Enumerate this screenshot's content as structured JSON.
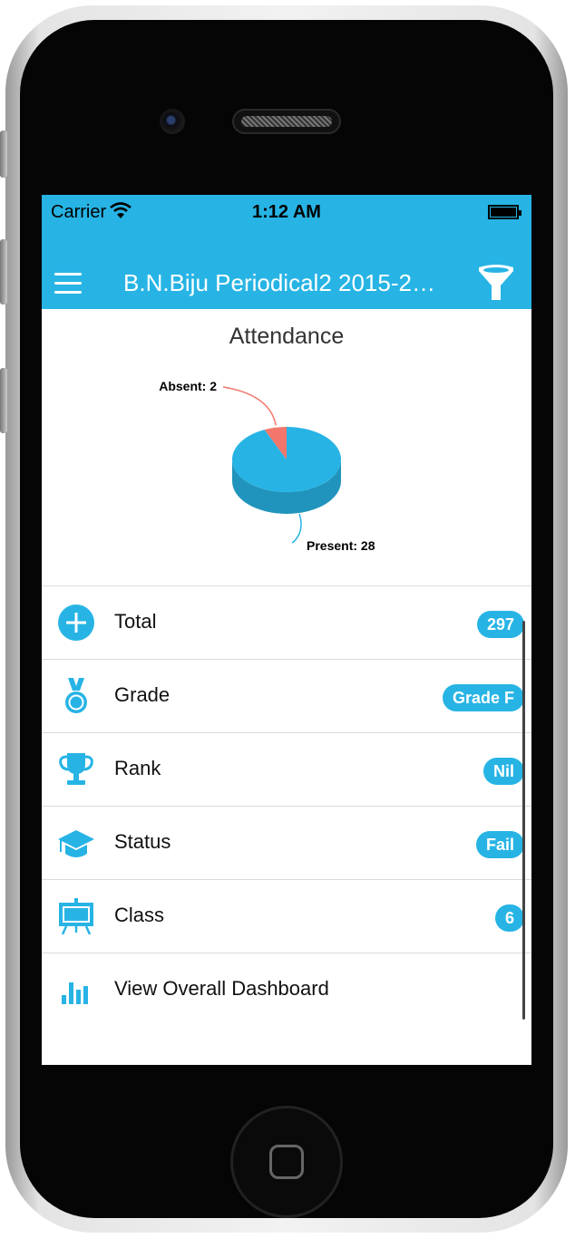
{
  "status_bar": {
    "carrier": "Carrier",
    "time": "1:12 AM"
  },
  "app_bar": {
    "title": "B.N.Biju Periodical2 2015-2…",
    "menu_icon": "hamburger-menu-icon",
    "filter_icon": "filter-funnel-icon"
  },
  "attendance": {
    "title": "Attendance",
    "chart_data": {
      "type": "pie",
      "categories": [
        "Absent",
        "Present"
      ],
      "values": [
        2,
        28
      ],
      "labels": [
        "Absent: 2",
        "Present: 28"
      ],
      "colors": [
        "#f2766b",
        "#27b4e5"
      ]
    }
  },
  "list": [
    {
      "label": "Total",
      "badge": "297",
      "icon": "plus-circle-icon"
    },
    {
      "label": "Grade",
      "badge": "Grade F",
      "icon": "medal-icon"
    },
    {
      "label": "Rank",
      "badge": "Nil",
      "icon": "trophy-icon"
    },
    {
      "label": "Status",
      "badge": "Fail",
      "icon": "graduation-cap-icon"
    },
    {
      "label": "Class",
      "badge": "6",
      "icon": "presentation-board-icon"
    },
    {
      "label": "View Overall Dashboard",
      "badge": "",
      "icon": "bar-chart-icon"
    }
  ],
  "colors": {
    "accent": "#27b4e5",
    "absent": "#f2766b"
  }
}
